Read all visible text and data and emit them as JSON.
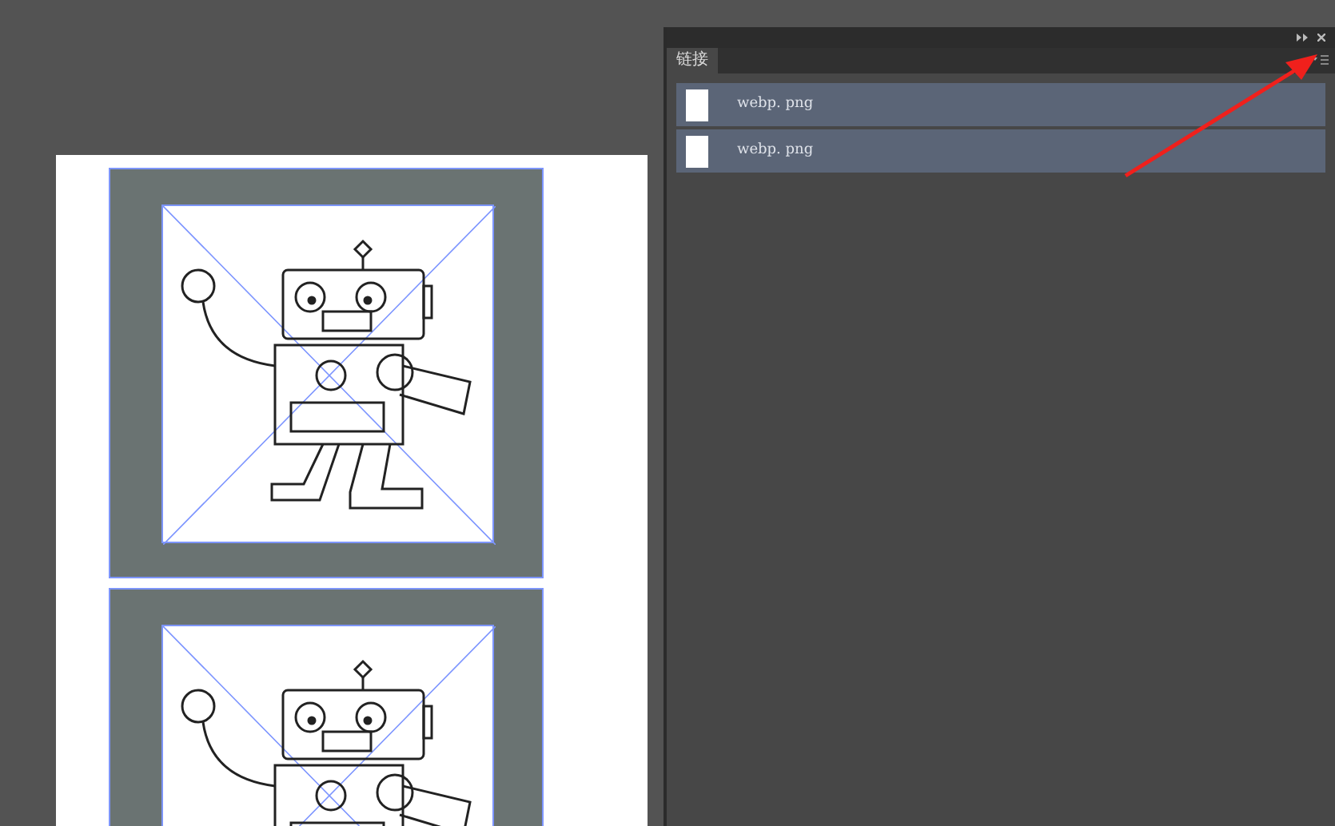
{
  "links_panel": {
    "tab": {
      "label": "链接",
      "selected": true
    },
    "rows": [
      {
        "name": "webp. png",
        "selected": true
      },
      {
        "name": "webp. png",
        "selected": true
      }
    ]
  }
}
